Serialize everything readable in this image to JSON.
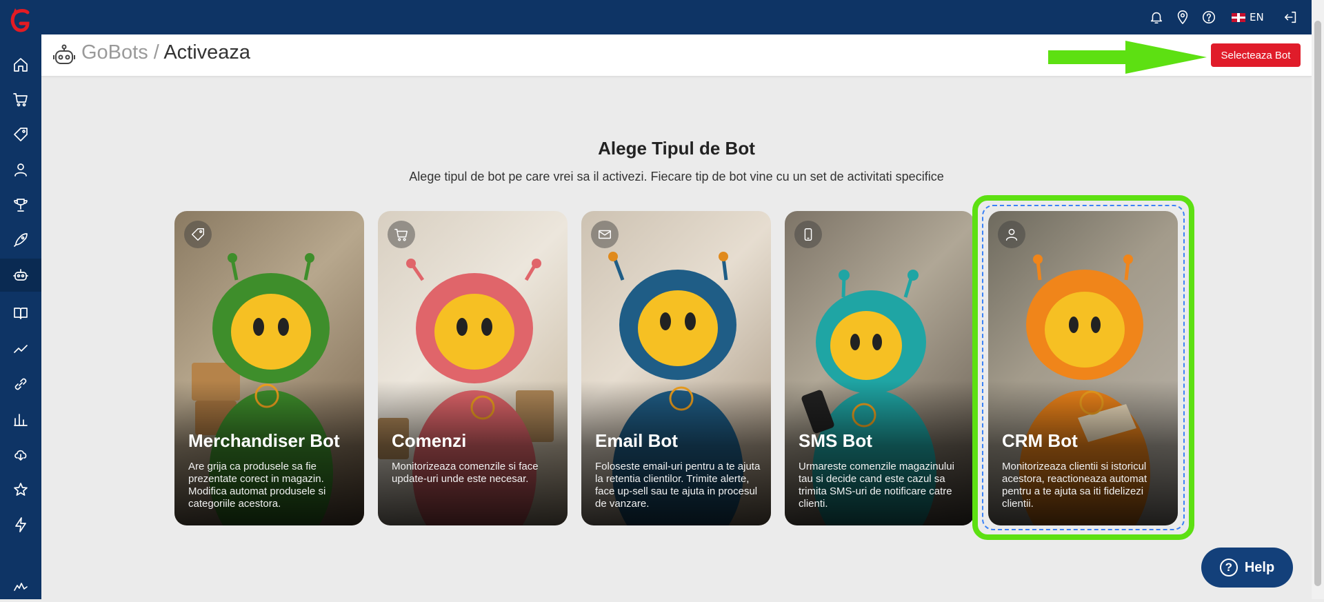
{
  "breadcrumb": {
    "root": "GoBots",
    "separator": "/",
    "current": "Activeaza"
  },
  "header": {
    "select_button": "Selecteaza Bot"
  },
  "topbar": {
    "language": "EN"
  },
  "page": {
    "title": "Alege Tipul de Bot",
    "subtitle": "Alege tipul de bot pe care vrei sa il activezi. Fiecare tip de bot vine cu un set de activitati specifice"
  },
  "bots": [
    {
      "name": "Merchandiser Bot",
      "description": "Are grija ca produsele sa fie prezentate corect in magazin. Modifica automat produsele si categoriile acestora.",
      "icon": "tag-icon",
      "color": "#3e8e2b"
    },
    {
      "name": "Comenzi",
      "description": "Monitorizeaza comenzile si face update-uri unde este necesar.",
      "icon": "cart-icon",
      "color": "#e0656a"
    },
    {
      "name": "Email Bot",
      "description": "Foloseste email-uri pentru a te ajuta la retentia clientilor. Trimite alerte, face up-sell sau te ajuta in procesul de vanzare.",
      "icon": "mail-icon",
      "color": "#1f5d86"
    },
    {
      "name": "SMS Bot",
      "description": "Urmareste comenzile magazinului tau si decide cand este cazul sa trimita SMS-uri de notificare catre clienti.",
      "icon": "phone-icon",
      "color": "#1fa5a4"
    },
    {
      "name": "CRM Bot",
      "description": "Monitorizeaza clientii si istoricul acestora, reactioneaza automat pentru a te ajuta sa iti fidelizezi clientii.",
      "icon": "user-icon",
      "color": "#f0851a",
      "selected": true
    }
  ],
  "help": {
    "label": "Help"
  },
  "colors": {
    "navy": "#0e3465",
    "accent_red": "#e01c2a",
    "highlight_green": "#5de012"
  }
}
